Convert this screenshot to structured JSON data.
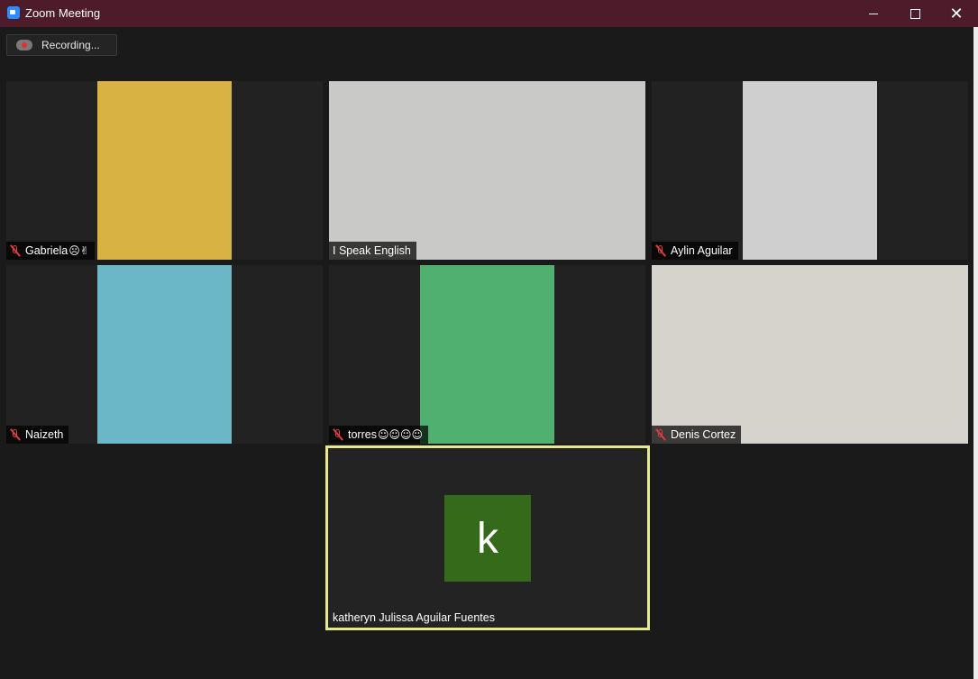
{
  "window": {
    "title": "Zoom Meeting",
    "minimize_label": "",
    "maximize_label": "",
    "close_label": "✕"
  },
  "recording": {
    "label": "Recording..."
  },
  "participants": [
    {
      "name": "Gabriela",
      "suffix": "☹✌",
      "muted": true,
      "bg": "#d8b243"
    },
    {
      "name": "I Speak English",
      "suffix": "",
      "muted": false,
      "bg": "#c9c9c7"
    },
    {
      "name": "Aylin Aguilar",
      "suffix": "",
      "muted": true,
      "bg": "#cfcfcf"
    },
    {
      "name": "Naizeth",
      "suffix": "",
      "muted": true,
      "bg": "#6bb6c7"
    },
    {
      "name": "torres",
      "suffix": "☺☺☺☺",
      "muted": true,
      "bg": "#4fb070"
    },
    {
      "name": "Denis Cortez",
      "suffix": "",
      "muted": true,
      "bg": "#d6d3cd"
    }
  ],
  "active_speaker": {
    "name": "katheryn Julissa Aguilar Fuentes",
    "initial": "k",
    "avatar_color": "#356a1b",
    "border_color": "#e7e98a"
  }
}
